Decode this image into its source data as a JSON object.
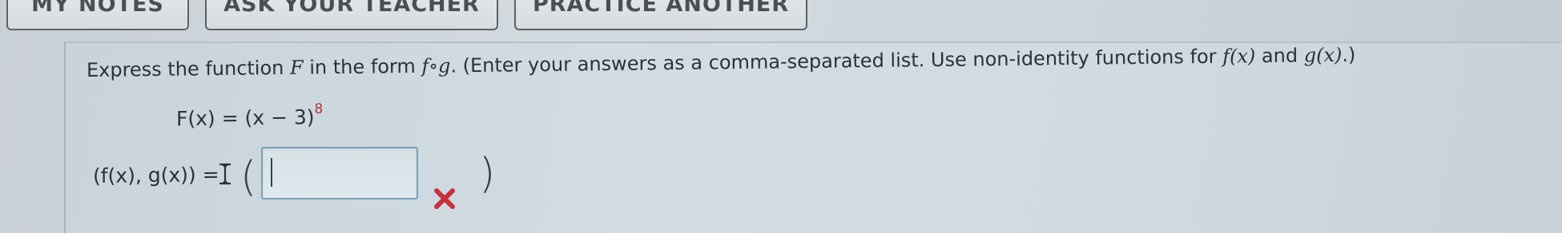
{
  "toolbar": {
    "my_notes": "MY NOTES",
    "ask_teacher": "ASK YOUR TEACHER",
    "practice_another": "PRACTICE ANOTHER"
  },
  "question": {
    "prompt_part1": "Express the function ",
    "prompt_F": "F",
    "prompt_part2": " in the form ",
    "prompt_fog": "f∘g",
    "prompt_part3": ". (Enter your answers as a comma-separated list. Use non-identity functions for ",
    "prompt_fx": "f(x)",
    "prompt_and": " and ",
    "prompt_gx": "g(x)",
    "prompt_end": ".)",
    "formula_base": "F(x) = (x − 3)",
    "formula_exponent": "8"
  },
  "answer": {
    "label": "(f(x), g(x)) =",
    "paren_open": "(",
    "paren_close": ")",
    "value": "",
    "status": "incorrect"
  },
  "colors": {
    "exponent": "#b1323a",
    "incorrect_mark": "#c8303d",
    "input_border": "#7b9fb8"
  },
  "icons": {
    "incorrect": "x-mark-icon",
    "cursor": "text-cursor-icon"
  }
}
